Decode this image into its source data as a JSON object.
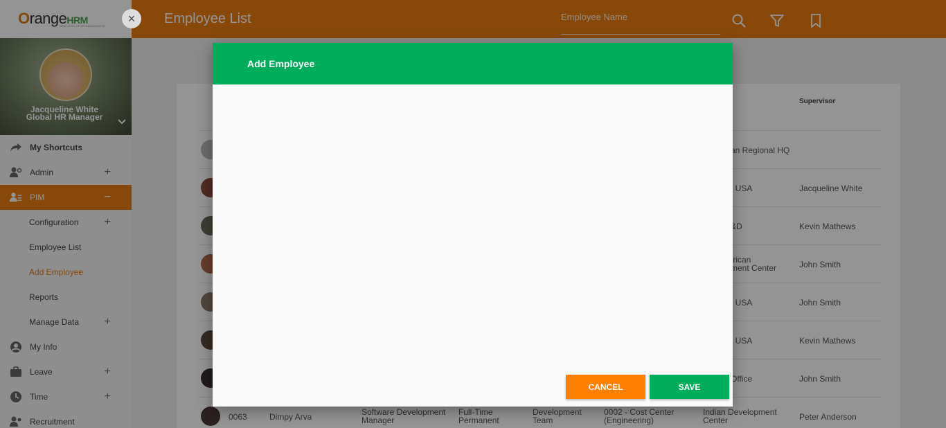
{
  "logo": {
    "brand_o": "O",
    "brand_range": "range",
    "brand_hrm": "HRM",
    "tagline": "NEW LEVEL OF HR MANAGEMENT"
  },
  "sidebar": {
    "close_icon": "×",
    "profile": {
      "name": "Jacqueline White",
      "role": "Global HR Manager"
    },
    "nav": [
      {
        "label": "My Shortcuts",
        "icon": "share-arrow-icon"
      },
      {
        "label": "Admin",
        "icon": "admin-user-icon"
      },
      {
        "label": "PIM",
        "icon": "pim-id-card-icon"
      },
      {
        "label": "My Info",
        "icon": "user-circle-icon"
      },
      {
        "label": "Leave",
        "icon": "briefcase-icon"
      },
      {
        "label": "Time",
        "icon": "clock-icon"
      },
      {
        "label": "Recruitment",
        "icon": "recruitment-user-icon"
      }
    ],
    "pim_sub": [
      {
        "label": "Configuration"
      },
      {
        "label": "Employee List"
      },
      {
        "label": "Add Employee"
      },
      {
        "label": "Reports"
      },
      {
        "label": "Manage Data"
      }
    ]
  },
  "topbar": {
    "title": "Employee List",
    "search_placeholder": "Employee Name",
    "icons": [
      "search-icon",
      "filter-icon",
      "bookmark-icon"
    ]
  },
  "table": {
    "header_supervisor": "Supervisor",
    "rows": [
      {
        "location": "an Regional HQ",
        "supervisor": ""
      },
      {
        "location": ", USA",
        "supervisor": "Jacqueline White"
      },
      {
        "location": "&D",
        "supervisor": "Kevin Mathews"
      },
      {
        "location_line1": "frican",
        "location_line2": "ment Center",
        "supervisor": "John Smith"
      },
      {
        "location": ", USA",
        "supervisor": "John Smith"
      },
      {
        "location": ", USA",
        "supervisor": "Kevin Mathews"
      },
      {
        "location": "Office",
        "supervisor": "John Smith"
      },
      {
        "id": "0063",
        "name": "Dimpy Arva",
        "job_line1": "Software Development",
        "job_line2": "Manager",
        "status_line1": "Full-Time",
        "status_line2": "Permanent",
        "unit_line1": "Development",
        "unit_line2": "Team",
        "cost_line1": "0002 - Cost Center",
        "cost_line2": "(Engineering)",
        "loc_line1": "Indian Development",
        "loc_line2": "Center",
        "supervisor": "Peter Anderson"
      }
    ]
  },
  "modal": {
    "title": "Add Employee",
    "cancel_label": "CANCEL",
    "save_label": "SAVE"
  },
  "colors": {
    "accent": "#e97c12",
    "success": "#00ad5b",
    "cancel": "#ff7f00"
  }
}
